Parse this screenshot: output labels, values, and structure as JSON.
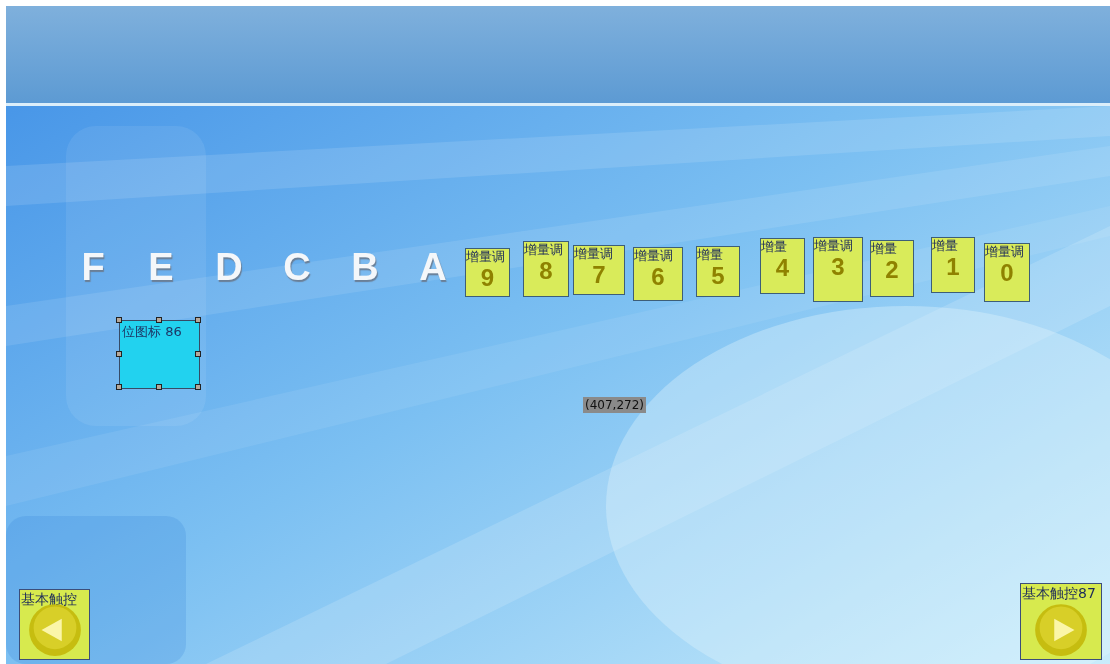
{
  "letters": [
    "F",
    "E",
    "D",
    "C",
    "B",
    "A"
  ],
  "counters": [
    {
      "label": "增量调",
      "digit": "9"
    },
    {
      "label": "增量调",
      "digit": "8"
    },
    {
      "label": "增量调",
      "digit": "7"
    },
    {
      "label": "增量调",
      "digit": "6"
    },
    {
      "label": "增量",
      "digit": "5"
    },
    {
      "label": "增量",
      "digit": "4"
    },
    {
      "label": "增量调",
      "digit": "3"
    },
    {
      "label": "增量",
      "digit": "2"
    },
    {
      "label": "增量",
      "digit": "1"
    },
    {
      "label": "增量调",
      "digit": "0"
    }
  ],
  "bitmap": {
    "label": "位图标 86",
    "selected": true
  },
  "cursor_coordinates": "(407,272)",
  "nav_buttons": [
    {
      "kind": "left",
      "label": "基本触控"
    },
    {
      "kind": "right",
      "label": "基本触控87"
    }
  ]
}
